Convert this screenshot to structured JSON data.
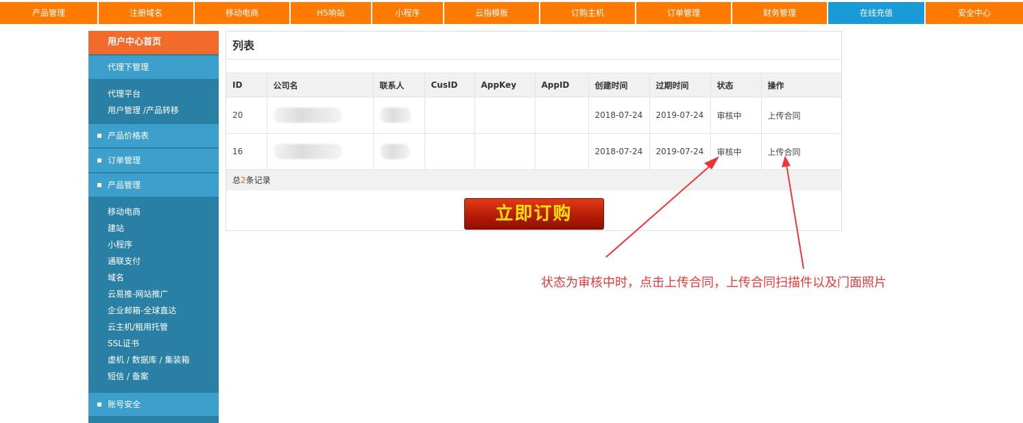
{
  "topnav": {
    "items": [
      {
        "label": "产品管理",
        "active": false
      },
      {
        "label": "注册域名",
        "active": false
      },
      {
        "label": "移动电商",
        "active": false
      },
      {
        "label": "H5响站",
        "active": false
      },
      {
        "label": "小程序",
        "active": false
      },
      {
        "label": "云指模板",
        "active": false
      },
      {
        "label": "订购主机",
        "active": false
      },
      {
        "label": "订单管理",
        "active": false
      },
      {
        "label": "财务管理",
        "active": false
      },
      {
        "label": "在线充值",
        "active": true
      },
      {
        "label": "安全中心",
        "active": false
      }
    ]
  },
  "sidebar": {
    "home": "用户中心首页",
    "agent_header": "代理下管理",
    "agent_items": [
      "代理平台",
      "用户管理 /产品转移"
    ],
    "sections": {
      "price": "产品价格表",
      "orders": "订单管理",
      "products": "产品管理",
      "account": "账号安全"
    },
    "product_items": [
      "移动电商",
      "建站",
      "小程序",
      "通联支付",
      "域名",
      "云易推-网站推广",
      "企业邮箱-全球直达",
      "云主机/租用托管",
      "SSL证书",
      "虚机 / 数据库 / 集装箱",
      "短信 / 备案"
    ]
  },
  "panel": {
    "title": "列表",
    "columns": [
      "ID",
      "公司名",
      "联系人",
      "CusID",
      "AppKey",
      "AppID",
      "创建时间",
      "过期时间",
      "状态",
      "操作"
    ],
    "rows": [
      {
        "id": "20",
        "created": "2018-07-24",
        "expires": "2019-07-24",
        "status": "审核中",
        "action": "上传合同"
      },
      {
        "id": "16",
        "created": "2018-07-24",
        "expires": "2019-07-24",
        "status": "审核中",
        "action": "上传合同"
      }
    ],
    "footer": {
      "prefix": "总",
      "count": "2",
      "suffix": "条记录"
    },
    "buy_button": "立即订购"
  },
  "annotation": {
    "text": "状态为审核中时，点击上传合同，上传合同扫描件以及门面照片",
    "color": "#e4393c"
  },
  "colors": {
    "nav_orange": "#ff7a00",
    "nav_active": "#1a9ad6",
    "sidebar_dark": "#2a7fa5",
    "sidebar_light": "#3d9fcb",
    "home_orange": "#f26b2b"
  }
}
